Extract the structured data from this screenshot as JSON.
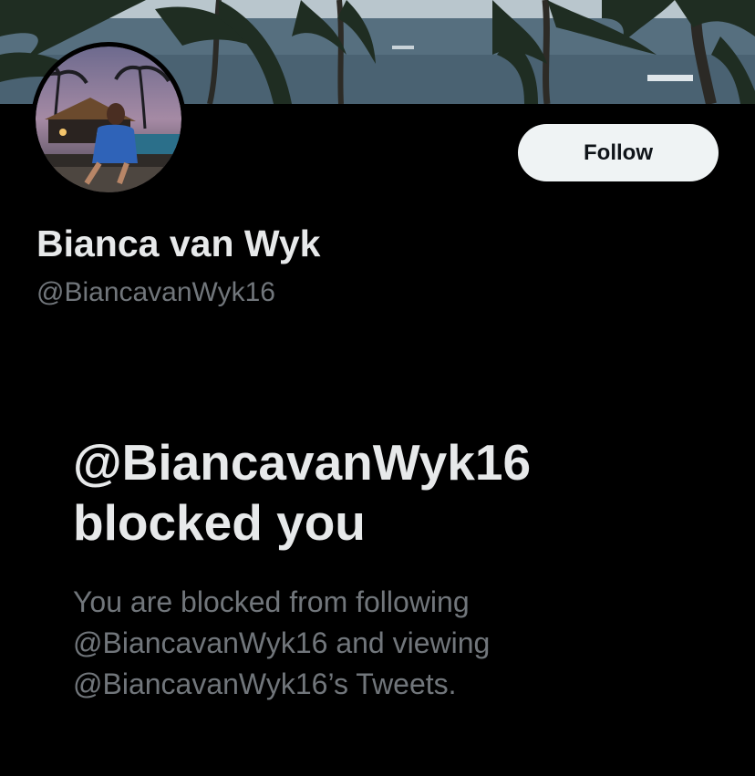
{
  "profile": {
    "display_name": "Bianca van Wyk",
    "handle": "@BiancavanWyk16",
    "follow_label": "Follow",
    "banner_icon": "palm-beach-banner",
    "avatar_icon": "profile-photo"
  },
  "blocked_notice": {
    "title_line1": "@BiancavanWyk16",
    "title_line2": "blocked you",
    "body_line1": "You are blocked from following",
    "body_line2": "@BiancavanWyk16 and viewing",
    "body_line3": "@BiancavanWyk16’s Tweets."
  },
  "colors": {
    "background": "#000000",
    "primary_text": "#e7e9ea",
    "secondary_text": "#71767b",
    "follow_bg": "#eff3f4",
    "follow_text": "#0f1419"
  }
}
